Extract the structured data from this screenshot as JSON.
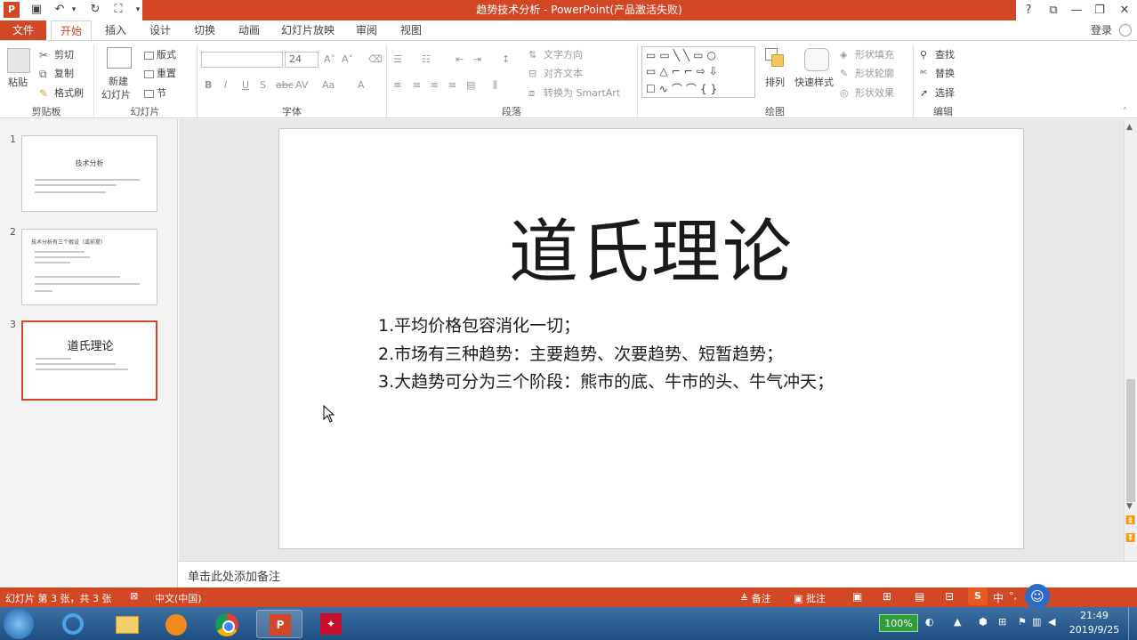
{
  "window": {
    "title": "趋势技术分析 - PowerPoint(产品激活失败)",
    "help": "?",
    "controls": [
      "⧉",
      "—",
      "❐",
      "✕"
    ]
  },
  "tabs": [
    {
      "label": "文件"
    },
    {
      "label": "开始"
    },
    {
      "label": "插入"
    },
    {
      "label": "设计"
    },
    {
      "label": "切换"
    },
    {
      "label": "动画"
    },
    {
      "label": "幻灯片放映"
    },
    {
      "label": "审阅"
    },
    {
      "label": "视图"
    }
  ],
  "account": {
    "login": "登录"
  },
  "ribbon": {
    "clipboard": {
      "label": "剪贴板",
      "paste": "粘贴",
      "cut": "剪切",
      "copy": "复制",
      "format_painter": "格式刷"
    },
    "slides": {
      "label": "幻灯片",
      "new_slide": "新建",
      "new_slide2": "幻灯片",
      "layout": "版式",
      "reset": "重置",
      "section": "节"
    },
    "font": {
      "label": "字体",
      "font_size": "24"
    },
    "paragraph": {
      "label": "段落",
      "text_direction": "文字方向",
      "align_text": "对齐文本",
      "smartart": "转换为 SmartArt"
    },
    "drawing": {
      "label": "绘图",
      "arrange": "排列",
      "quick_styles": "快速样式",
      "shape_fill": "形状填充",
      "shape_outline": "形状轮廓",
      "shape_effects": "形状效果"
    },
    "editing": {
      "label": "编辑",
      "find": "查找",
      "replace": "替换",
      "select": "选择"
    }
  },
  "thumbnails": [
    {
      "num": "1",
      "title": "技术分析"
    },
    {
      "num": "2",
      "title": "技术分析有三个假设（或前提）"
    },
    {
      "num": "3",
      "title": "道氏理论"
    }
  ],
  "slide": {
    "title": "道氏理论",
    "bullets": [
      "1.平均价格包容消化一切；",
      "2.市场有三种趋势：主要趋势、次要趋势、短暂趋势；",
      "3.大趋势可分为三个阶段：熊市的底、牛市的头、牛气冲天；"
    ]
  },
  "notes": {
    "placeholder": "单击此处添加备注"
  },
  "status": {
    "slide_info": "幻灯片 第 3 张，共 3 张",
    "language": "中文(中国)",
    "notes_btn": "备注",
    "comments_btn": "批注"
  },
  "taskbar": {
    "battery": "100%",
    "time": "21:49",
    "date": "2019/9/25",
    "ime": "中"
  },
  "colors": {
    "accent": "#d24726",
    "taskbar": "#2a5b8f"
  }
}
